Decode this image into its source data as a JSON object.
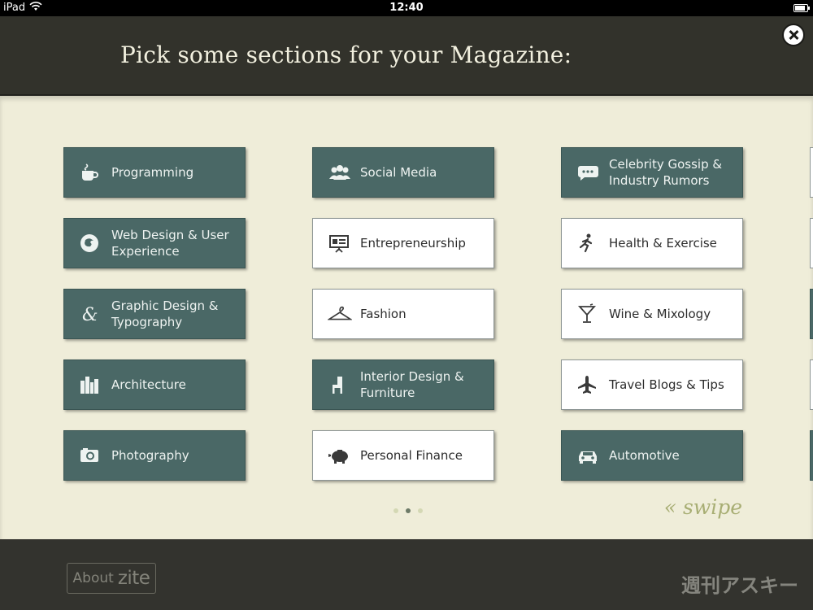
{
  "status_bar": {
    "carrier": "iPad",
    "time": "12:40"
  },
  "header": {
    "title": "Pick some sections for your Magazine:"
  },
  "sections": [
    {
      "label": "Programming",
      "icon": "coffee-cup-icon",
      "selected": true
    },
    {
      "label": "Web Design & User Experience",
      "icon": "firefox-icon",
      "selected": true
    },
    {
      "label": "Graphic Design & Typography",
      "icon": "ampersand-icon",
      "selected": true
    },
    {
      "label": "Architecture",
      "icon": "buildings-icon",
      "selected": true
    },
    {
      "label": "Photography",
      "icon": "camera-icon",
      "selected": true
    },
    {
      "label": "Social Media",
      "icon": "people-icon",
      "selected": true
    },
    {
      "label": "Entrepreneurship",
      "icon": "presentation-board-icon",
      "selected": false
    },
    {
      "label": "Fashion",
      "icon": "hanger-icon",
      "selected": false
    },
    {
      "label": "Interior Design & Furniture",
      "icon": "chair-icon",
      "selected": true
    },
    {
      "label": "Personal Finance",
      "icon": "piggy-bank-icon",
      "selected": false
    },
    {
      "label": "Celebrity Gossip & Industry Rumors",
      "icon": "speech-bubble-icon",
      "selected": true
    },
    {
      "label": "Health & Exercise",
      "icon": "running-person-icon",
      "selected": false
    },
    {
      "label": "Wine & Mixology",
      "icon": "cocktail-glass-icon",
      "selected": false
    },
    {
      "label": "Travel Blogs & Tips",
      "icon": "airplane-icon",
      "selected": false
    },
    {
      "label": "Automotive",
      "icon": "car-icon",
      "selected": true
    }
  ],
  "pagination": {
    "pages": 3,
    "current": 2
  },
  "swipe_hint": "« swipe",
  "footer": {
    "about_prefix": "About",
    "about_brand": "zite"
  },
  "watermark": "週刊アスキー",
  "colors": {
    "selected": "#4a6866",
    "unselected": "#ffffff",
    "background": "#efedd9",
    "header": "#32322b"
  }
}
